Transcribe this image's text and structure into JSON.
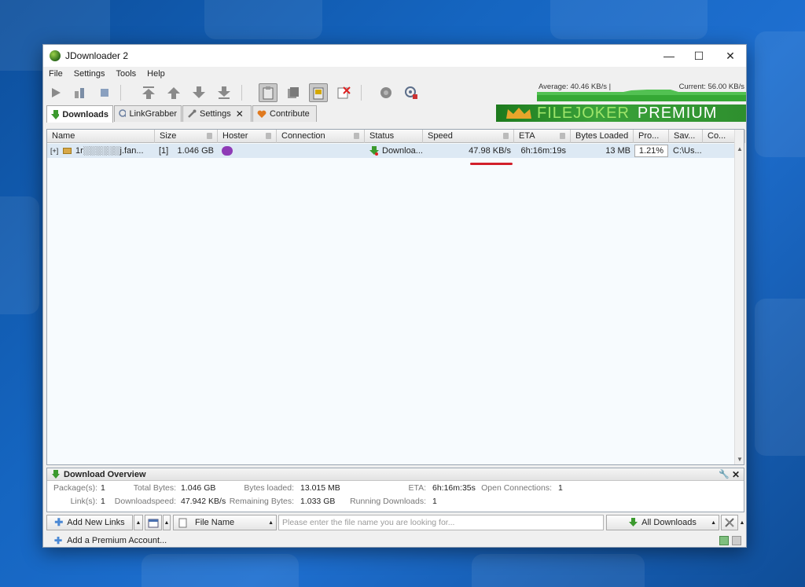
{
  "window": {
    "title": "JDownloader 2",
    "controls": {
      "minimize": "—",
      "maximize": "☐",
      "close": "✕"
    }
  },
  "menu": [
    "File",
    "Settings",
    "Tools",
    "Help"
  ],
  "toolbar": {
    "average_label": "Average: 40.46 KB/s |",
    "current_label": "Current: 56.00 KB/s",
    "buttons": [
      "play-icon",
      "pause-icon",
      "stop-icon",
      "move-top-icon",
      "move-up-icon",
      "move-down-icon",
      "move-bottom-icon",
      "clipboard-icon",
      "reconnect-icon",
      "auto-reconnect-icon",
      "cancel-icon",
      "update-icon",
      "premium-icon"
    ]
  },
  "tabs": [
    {
      "label": "Downloads"
    },
    {
      "label": "LinkGrabber"
    },
    {
      "label": "Settings"
    },
    {
      "label": "Contribute"
    }
  ],
  "banner": {
    "brand": "FILEJOKER",
    "tier": "PREMIUM"
  },
  "table": {
    "columns": [
      "Name",
      "Size",
      "Hoster",
      "Connection",
      "Status",
      "Speed",
      "ETA",
      "Bytes Loaded",
      "Pro...",
      "Sav...",
      "Co..."
    ],
    "rows": [
      {
        "expand": "[+]",
        "name": "1r░░░░░░j.fan...",
        "count": "[1]",
        "size": "1.046 GB",
        "status": "Downloa...",
        "speed": "47.98 KB/s",
        "eta": "6h:16m:19s",
        "bytes_loaded": "13 MB",
        "progress": "1.21%",
        "progress_value": 0.0121,
        "save_to": "C:\\Us..."
      }
    ]
  },
  "overview": {
    "title": "Download Overview",
    "labels": {
      "packages": "Package(s):",
      "links": "Link(s):",
      "total_bytes": "Total Bytes:",
      "download_speed": "Downloadspeed:",
      "bytes_loaded": "Bytes loaded:",
      "remaining_bytes": "Remaining Bytes:",
      "eta": "ETA:",
      "running_downloads": "Running Downloads:",
      "open_connections": "Open Connections:"
    },
    "values": {
      "packages": "1",
      "links": "1",
      "total_bytes": "1.046 GB",
      "download_speed": "47.942 KB/s",
      "bytes_loaded": "13.015 MB",
      "remaining_bytes": "1.033 GB",
      "eta": "6h:16m:35s",
      "running_downloads": "1",
      "open_connections": "1"
    }
  },
  "bottom": {
    "add_links": "Add New Links",
    "file_name_filter": "File Name",
    "search_placeholder": "Please enter the file name you are looking for...",
    "all_downloads": "All Downloads"
  },
  "statusbar": {
    "add_premium": "Add a Premium Account..."
  },
  "colors": {
    "accent": "#3c9a2e",
    "selection": "#dde9f4",
    "highlight": "#d21f2b"
  }
}
